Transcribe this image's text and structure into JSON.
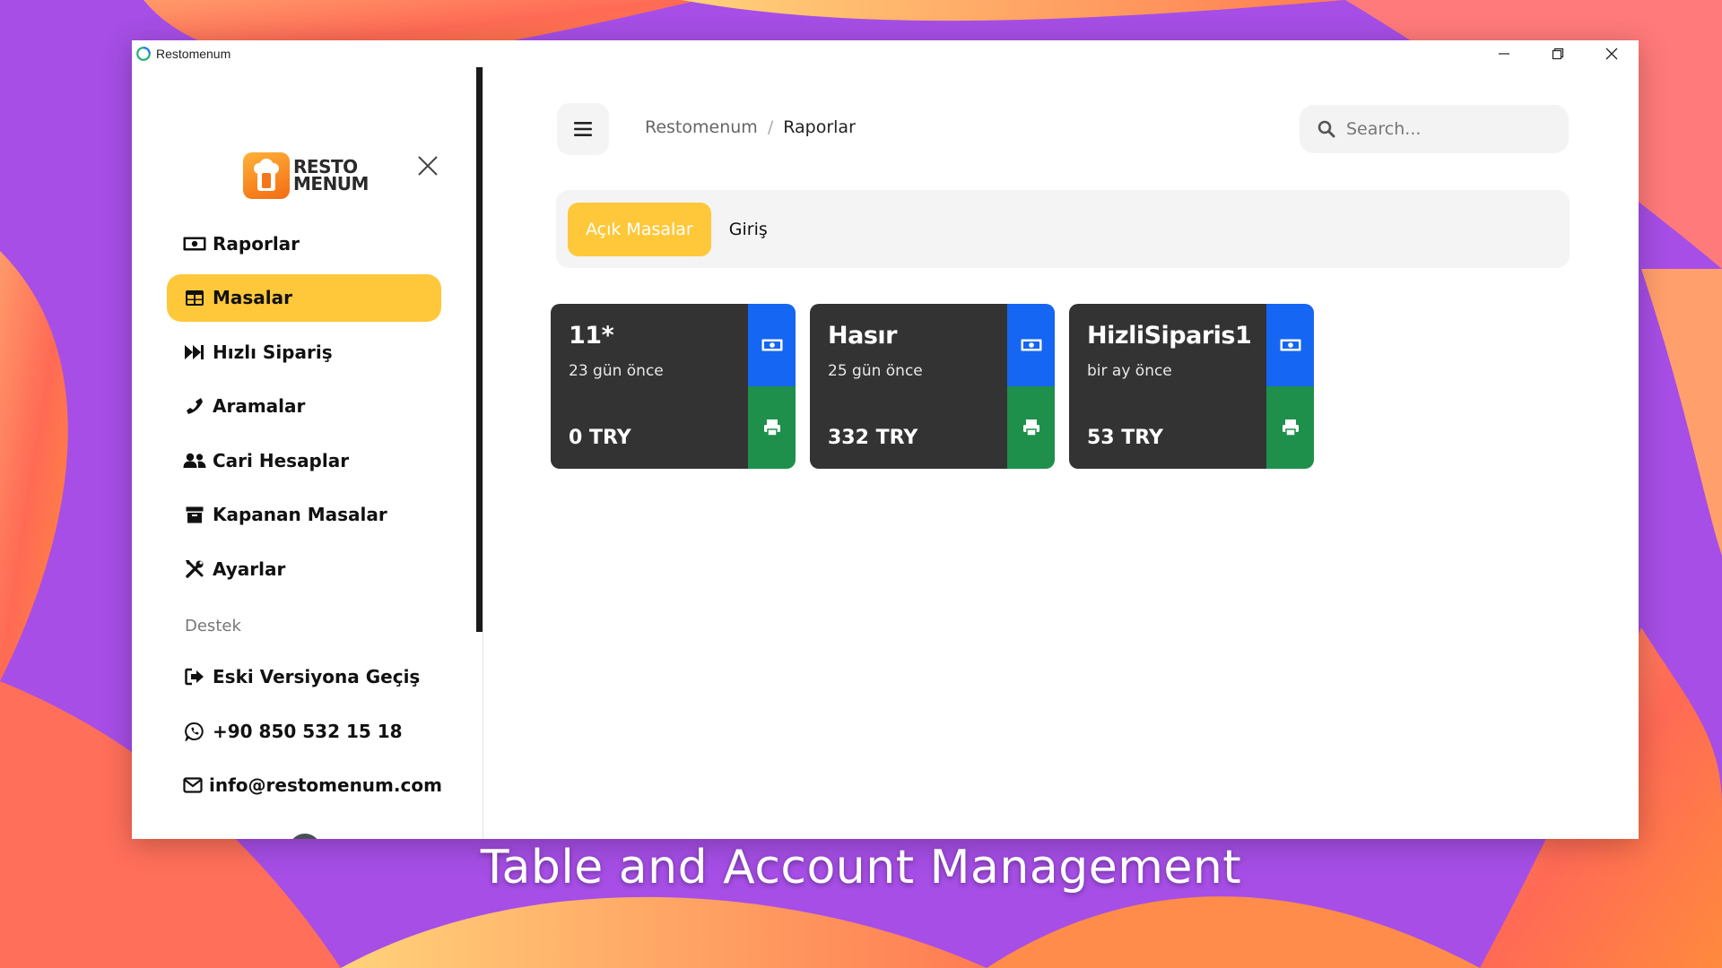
{
  "window": {
    "title": "Restomenum",
    "controls": [
      "minimize-icon",
      "restore-icon",
      "close-icon"
    ]
  },
  "sidebar": {
    "logo": {
      "line1": "RESTO",
      "line2": "MENUM"
    },
    "items": [
      {
        "label": "Raporlar",
        "icon": "money-bill-icon",
        "active": false
      },
      {
        "label": "Masalar",
        "icon": "table-icon",
        "active": true
      },
      {
        "label": "Hızlı Sipariş",
        "icon": "fast-forward-icon",
        "active": false
      },
      {
        "label": "Aramalar",
        "icon": "phone-icon",
        "active": false
      },
      {
        "label": "Cari Hesaplar",
        "icon": "users-icon",
        "active": false
      },
      {
        "label": "Kapanan Masalar",
        "icon": "archive-icon",
        "active": false
      },
      {
        "label": "Ayarlar",
        "icon": "tools-icon",
        "active": false
      }
    ],
    "section_label": "Destek",
    "support_items": [
      {
        "label": "Eski Versiyona Geçiş",
        "icon": "sign-out-icon"
      },
      {
        "label": "+90 850 532 15 18",
        "icon": "whatsapp-icon"
      },
      {
        "label": "info@restomenum.com",
        "icon": "envelope-icon"
      }
    ]
  },
  "header": {
    "breadcrumb": {
      "root": "Restomenum",
      "separator": "/",
      "current": "Raporlar"
    },
    "search": {
      "placeholder": "Search...",
      "value": ""
    }
  },
  "tabs": [
    {
      "label": "Açık Masalar",
      "active": true
    },
    {
      "label": "Giriş",
      "active": false
    }
  ],
  "cards": [
    {
      "title": "11*",
      "time": "23 gün önce",
      "amount": "0 TRY"
    },
    {
      "title": "Hasır",
      "time": "25 gün önce",
      "amount": "332 TRY"
    },
    {
      "title": "HizliSiparis1",
      "time": "bir ay önce",
      "amount": "53 TRY"
    }
  ],
  "caption": "Table and Account Management",
  "colors": {
    "accent": "#ffc83a",
    "card_bg": "#333333",
    "pay_blue": "#1566f2",
    "print_green": "#1f8f4c"
  }
}
